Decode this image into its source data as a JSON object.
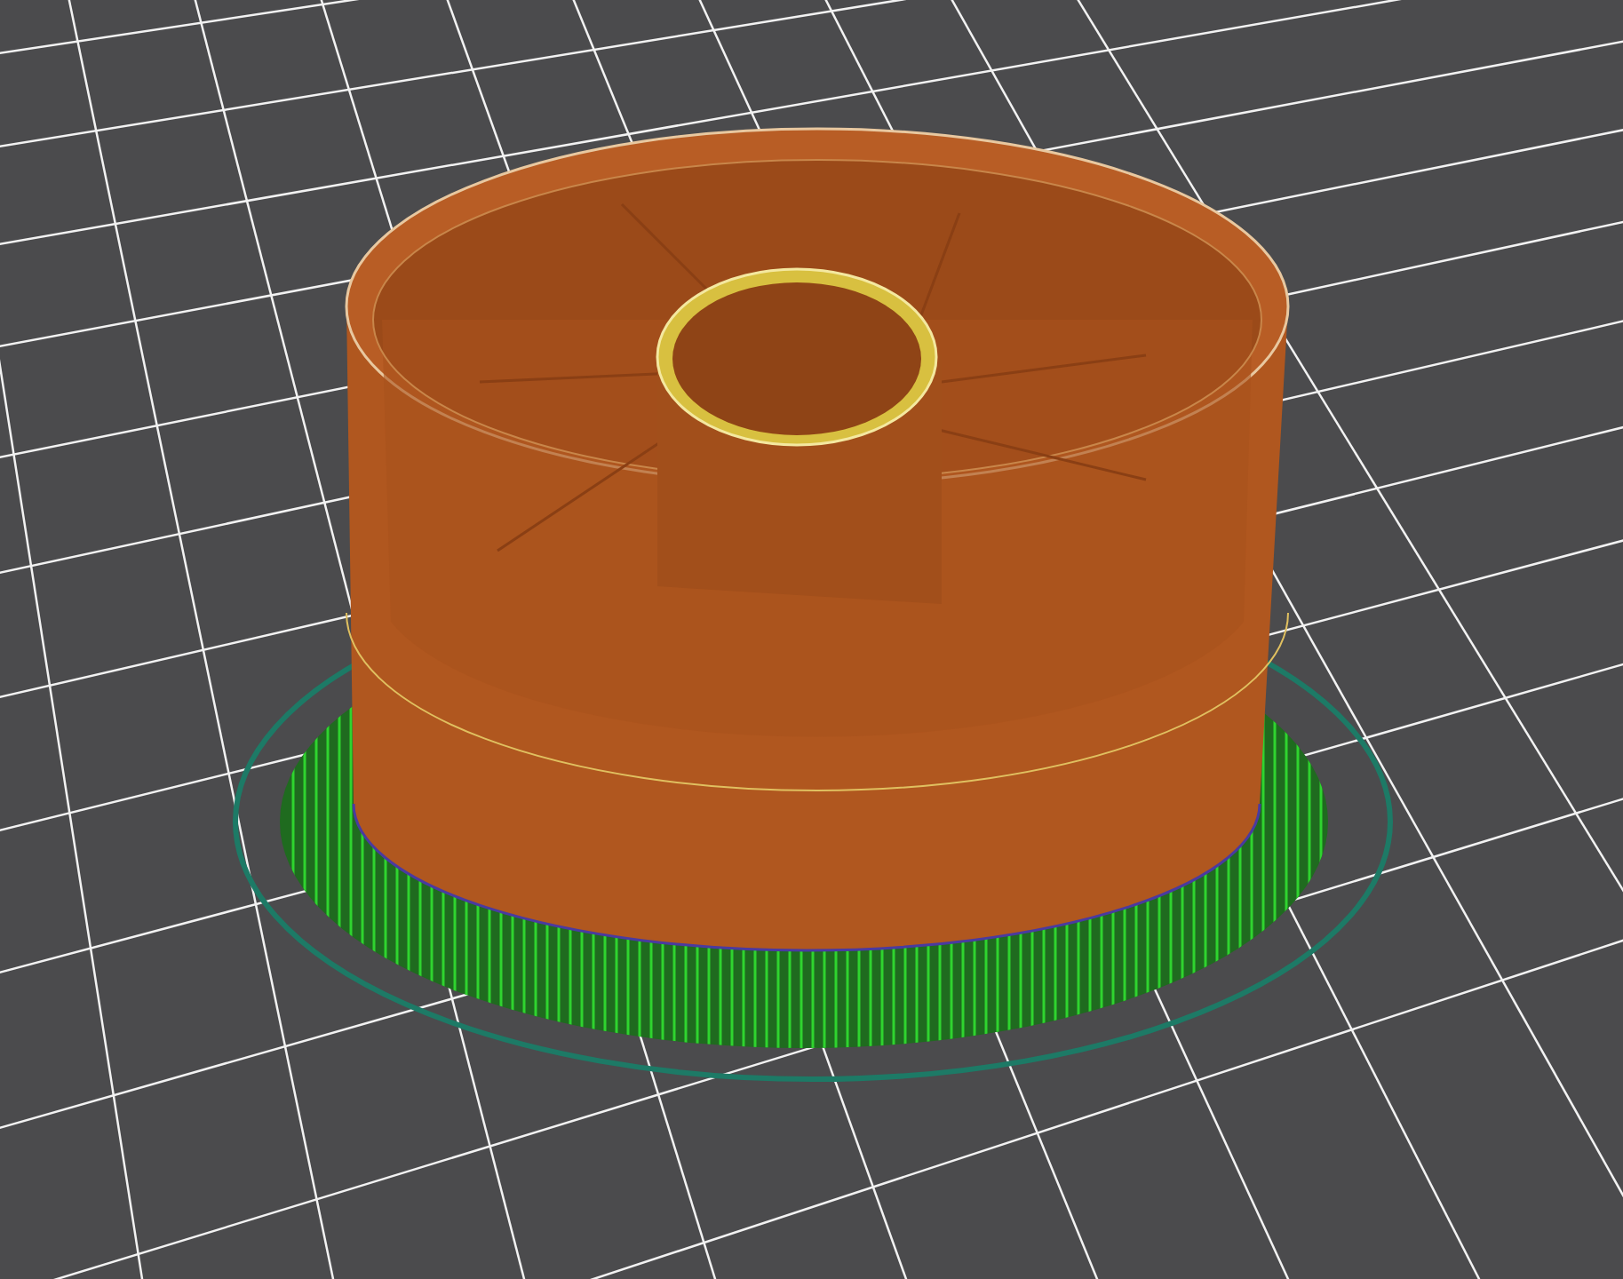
{
  "viewport": {
    "objects": [
      {
        "kind": "skirt"
      },
      {
        "kind": "support"
      },
      {
        "kind": "model"
      }
    ]
  }
}
